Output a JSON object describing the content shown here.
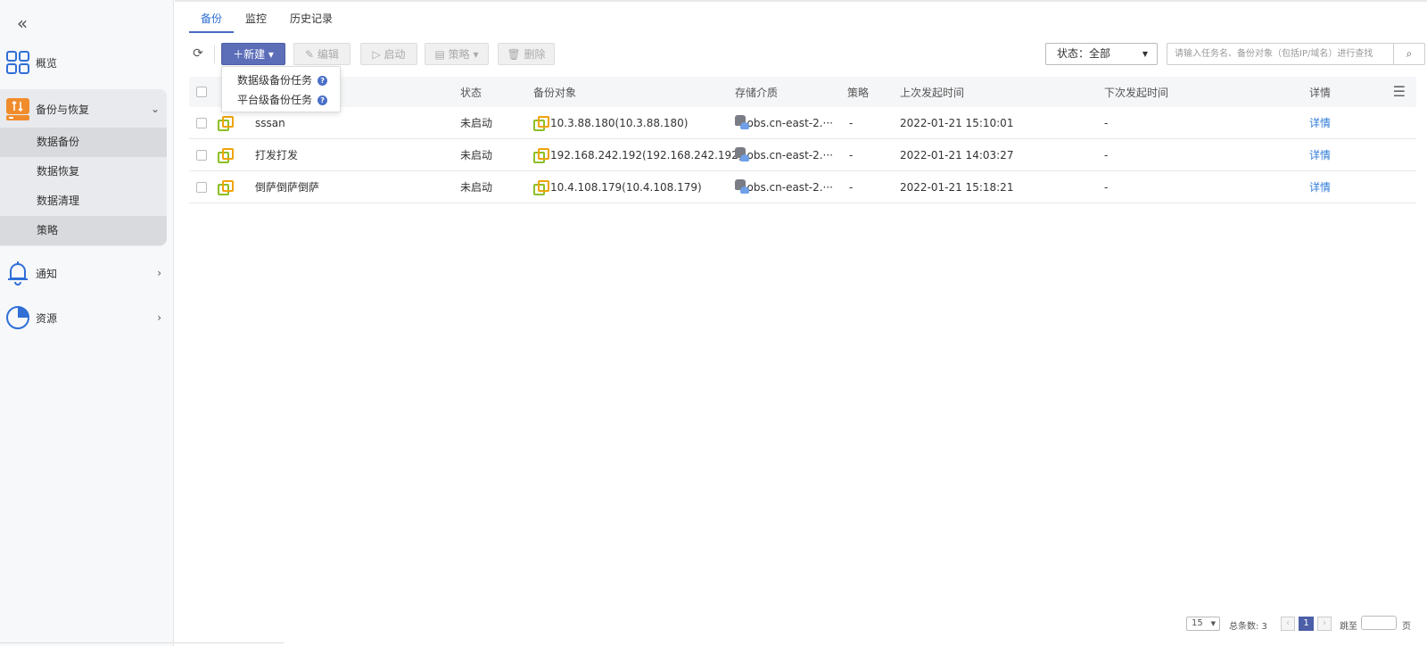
{
  "sidebar": {
    "items": [
      {
        "label": "概览",
        "icon": "grid-icon"
      },
      {
        "label": "备份与恢复",
        "icon": "backup-icon",
        "children": [
          "数据备份",
          "数据恢复",
          "数据清理",
          "策略"
        ]
      },
      {
        "label": "通知",
        "icon": "bell-icon"
      },
      {
        "label": "资源",
        "icon": "pie-icon"
      }
    ]
  },
  "tabs": [
    "备份",
    "监控",
    "历史记录"
  ],
  "toolbar": {
    "new": "新建",
    "edit": "编辑",
    "start": "启动",
    "policy": "策略",
    "delete": "删除",
    "status_label": "状态：全部",
    "search_placeholder": "请输入任务名、备份对象（包括IP/域名）进行查找"
  },
  "dropdown": [
    "数据级备份任务",
    "平台级备份任务"
  ],
  "table": {
    "headers": [
      "状态",
      "备份对象",
      "存储介质",
      "策略",
      "上次发起时间",
      "下次发起时间",
      "详情"
    ],
    "rows": [
      {
        "name": "sssan",
        "status": "未启动",
        "object": "10.3.88.180(10.3.88.180)",
        "storage": "obs.cn-east-2.···",
        "policy": "-",
        "last": "2022-01-21 15:10:01",
        "next": "-",
        "detail": "详情"
      },
      {
        "name": "打发打发",
        "status": "未启动",
        "object": "192.168.242.192(192.168.242.192)",
        "storage": "obs.cn-east-2.···",
        "policy": "-",
        "last": "2022-01-21 14:03:27",
        "next": "-",
        "detail": "详情"
      },
      {
        "name": "倒萨倒萨倒萨",
        "status": "未启动",
        "object": "10.4.108.179(10.4.108.179)",
        "storage": "obs.cn-east-2.···",
        "policy": "-",
        "last": "2022-01-21 15:18:21",
        "next": "-",
        "detail": "详情"
      }
    ]
  },
  "pager": {
    "page_size": "15",
    "total": "总条数: 3",
    "current": "1",
    "jump": "跳至",
    "page_suffix": "页"
  },
  "colors": {
    "primary": "#5c6eb8",
    "link": "#2f7bd8",
    "accent": "#f08c2c"
  }
}
